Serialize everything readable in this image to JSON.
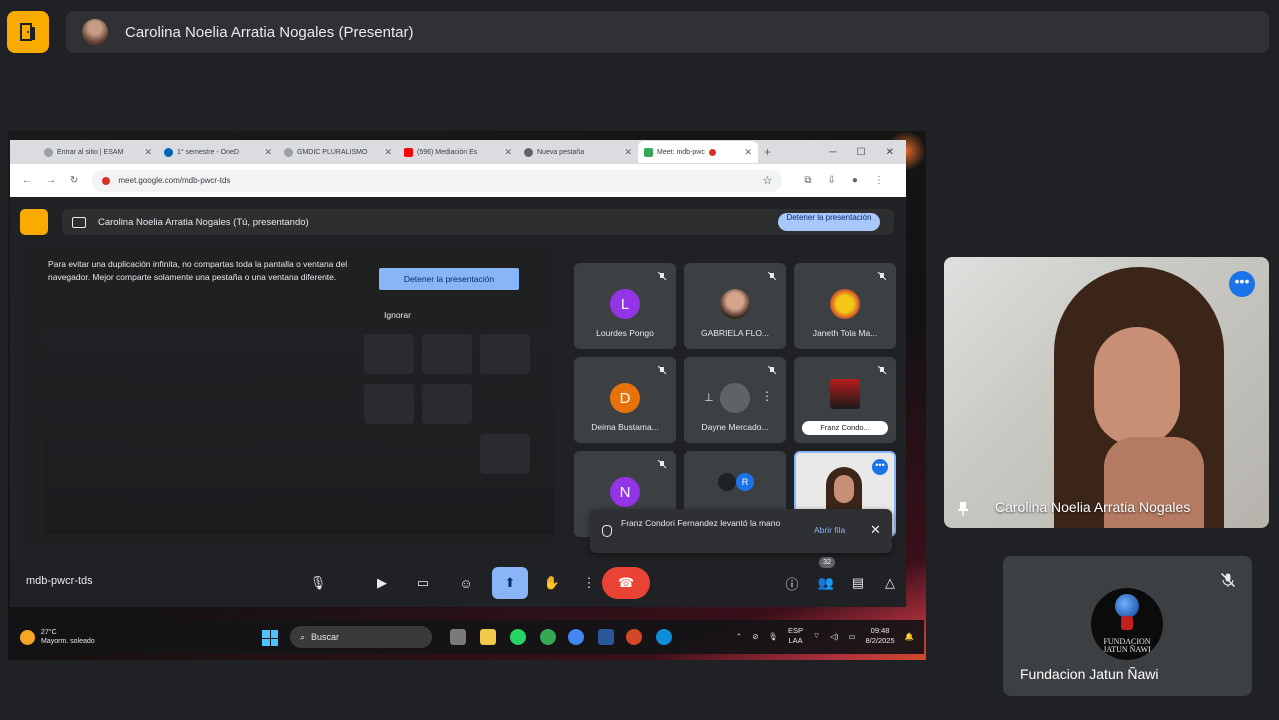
{
  "presenter_bar": {
    "title": "Carolina Noelia Arratia Nogales (Presentar)"
  },
  "browser": {
    "tabs": [
      {
        "label": "Entrar al sitio | ESAM"
      },
      {
        "label": "1° semestre - OneD"
      },
      {
        "label": "GMDIC PLURALISMO"
      },
      {
        "label": "(596) Mediación Es"
      },
      {
        "label": "Nueva pestaña"
      },
      {
        "label": "Meet: mdb-pwc"
      }
    ],
    "url": "meet.google.com/mdb-pwcr-tds"
  },
  "meet": {
    "top_label": "Carolina Noelia Arratia Nogales (Tú, presentando)",
    "stop_small_label": "Detener la presentación",
    "warning_text": "Para evitar una duplicación infinita, no compartas toda la pantalla o ventana del navegador. Mejor comparte solamente una pestaña o una ventana diferente.",
    "warning_stop": "Detener la presentación",
    "warning_ignore": "Ignorar",
    "tiles": [
      {
        "name": "Lourdes Pongo",
        "initial": "L",
        "color": "#9334e6"
      },
      {
        "name": "GABRIELA FLO..."
      },
      {
        "name": "Janeth Tola Ma..."
      },
      {
        "name": "Deima Bustama...",
        "initial": "D",
        "color": "#e8710a"
      },
      {
        "name": "Dayne Mercado..."
      },
      {
        "name": "Franz Condo..."
      },
      {
        "name": "",
        "initial": "N",
        "color": "#9334e6"
      },
      {
        "name": "",
        "initial": "R",
        "color": "#1a73e8"
      },
      {
        "name": ""
      }
    ],
    "toast": {
      "text": "Franz Condori Fernandez levantó la mano",
      "open": "Abrir fila"
    },
    "meeting_code": "mdb-pwcr-tds",
    "participant_count": "32"
  },
  "taskbar": {
    "temperature": "27°C",
    "weather": "Mayorm. soleado",
    "search": "Buscar",
    "lang_top": "ESP",
    "lang_bottom": "LAA",
    "time": "09:48",
    "date": "8/2/2025"
  },
  "participants": {
    "camera_name": "Carolina Noelia Arratia Nogales",
    "org_name": "Fundacion Jatun Ñawi",
    "org_logo_text": "FUNDACION JATUN ÑAWI"
  }
}
